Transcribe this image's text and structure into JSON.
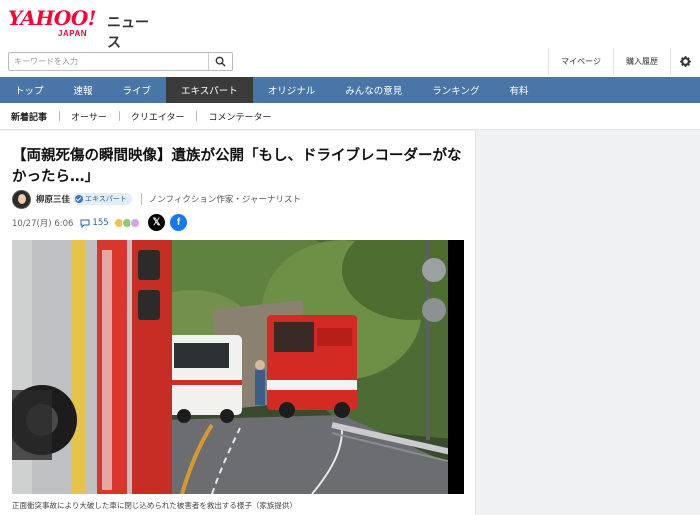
{
  "header": {
    "logo": "YAHOO!",
    "logo_sub": "JAPAN",
    "service": "ニュース",
    "search_placeholder": "キーワードを入力",
    "links": [
      "マイページ",
      "購入履歴"
    ]
  },
  "nav": {
    "items": [
      "トップ",
      "速報",
      "ライブ",
      "エキスパート",
      "オリジナル",
      "みんなの意見",
      "ランキング",
      "有料"
    ],
    "active": "エキスパート"
  },
  "subnav": {
    "items": [
      "新着記事",
      "オーサー",
      "クリエイター",
      "コメンテーター"
    ]
  },
  "article": {
    "title": "【両親死傷の瞬間映像】遺族が公開「もし、ドライブレコーダーがなかったら…」",
    "author_name": "柳原三佳",
    "badge": "エキスパート",
    "author_role": "ノンフィクション作家・ジャーナリスト",
    "date": "10/27(月) 6:06",
    "comment_count": "155",
    "caption": "正面衝突事故により大破した車に閉じ込められた被害者を救出する様子（家族提供）"
  },
  "colors": {
    "brand_red": "#ff0033",
    "nav_blue": "#4975a7",
    "nav_active": "#3b3b3b",
    "link_blue": "#2b5fa7"
  },
  "icons": {
    "search": "search-icon",
    "settings": "gear-icon",
    "comment": "comment-icon",
    "share_x": "x-icon",
    "share_facebook": "facebook-icon"
  }
}
